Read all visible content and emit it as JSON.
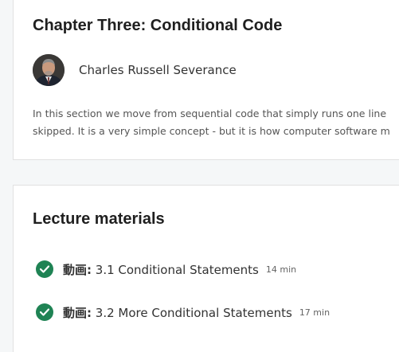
{
  "chapter": {
    "title": "Chapter Three: Conditional Code",
    "instructor": "Charles Russell Severance",
    "description_lines": [
      "In this section we move from sequential code that simply runs one line",
      "skipped. It is a very simple concept - but it is how computer software m"
    ]
  },
  "lectures": {
    "title": "Lecture materials",
    "items": [
      {
        "type": "動画:",
        "title": "3.1 Conditional Statements",
        "duration": "14 min",
        "completed": true
      },
      {
        "type": "動画:",
        "title": "3.2 More Conditional Statements",
        "duration": "17 min",
        "completed": true
      }
    ]
  },
  "colors": {
    "check": "#1f8354",
    "heading": "#1f1f1f",
    "text": "#333333"
  },
  "icons": {
    "completed": "checkmark-circle-icon",
    "avatar": "instructor-photo"
  }
}
